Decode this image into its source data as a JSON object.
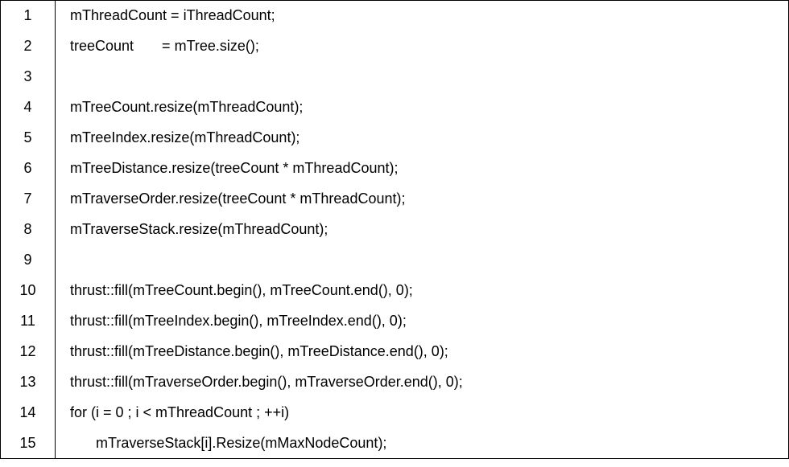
{
  "code": {
    "lines": [
      {
        "num": "1",
        "text": "mThreadCount = iThreadCount;",
        "indent": false
      },
      {
        "num": "2",
        "text": "treeCount       = mTree.size();",
        "indent": false
      },
      {
        "num": "3",
        "text": "",
        "indent": false
      },
      {
        "num": "4",
        "text": "mTreeCount.resize(mThreadCount);",
        "indent": false
      },
      {
        "num": "5",
        "text": "mTreeIndex.resize(mThreadCount);",
        "indent": false
      },
      {
        "num": "6",
        "text": "mTreeDistance.resize(treeCount * mThreadCount);",
        "indent": false
      },
      {
        "num": "7",
        "text": "mTraverseOrder.resize(treeCount * mThreadCount);",
        "indent": false
      },
      {
        "num": "8",
        "text": "mTraverseStack.resize(mThreadCount);",
        "indent": false
      },
      {
        "num": "9",
        "text": "",
        "indent": false
      },
      {
        "num": "10",
        "text": "thrust::fill(mTreeCount.begin(), mTreeCount.end(), 0);",
        "indent": false
      },
      {
        "num": "11",
        "text": "thrust::fill(mTreeIndex.begin(), mTreeIndex.end(), 0);",
        "indent": false
      },
      {
        "num": "12",
        "text": "thrust::fill(mTreeDistance.begin(), mTreeDistance.end(), 0);",
        "indent": false
      },
      {
        "num": "13",
        "text": "thrust::fill(mTraverseOrder.begin(), mTraverseOrder.end(), 0);",
        "indent": false
      },
      {
        "num": "14",
        "text": "for (i = 0 ; i < mThreadCount ; ++i)",
        "indent": false
      },
      {
        "num": "15",
        "text": "mTraverseStack[i].Resize(mMaxNodeCount);",
        "indent": true
      }
    ]
  }
}
